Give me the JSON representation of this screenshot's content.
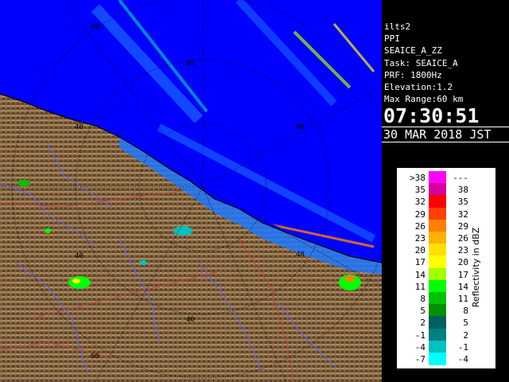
{
  "info": {
    "station": "ilts2",
    "mode": "PPI",
    "product": "SEAICE_A_ZZ",
    "task": "Task: SEAICE_A",
    "prf": "PRF: 1800Hz",
    "elevation": "Elevation:1.2",
    "max_range": "Max Range:60 km",
    "time": "07:30:51",
    "date": "30 MAR 2018 JST"
  },
  "range_labels": {
    "r40": "40",
    "r60": "60"
  },
  "legend": {
    "unit_label": "Reflectivity in dBZ",
    "rows": [
      {
        "lo": ">38",
        "hi": "---",
        "color": "#ff00ff"
      },
      {
        "lo": "35",
        "hi": "38",
        "color": "#d400a0"
      },
      {
        "lo": "32",
        "hi": "35",
        "color": "#ff0000"
      },
      {
        "lo": "29",
        "hi": "32",
        "color": "#ff4000"
      },
      {
        "lo": "26",
        "hi": "29",
        "color": "#ff8000"
      },
      {
        "lo": "23",
        "hi": "26",
        "color": "#ffb000"
      },
      {
        "lo": "20",
        "hi": "23",
        "color": "#ffe000"
      },
      {
        "lo": "17",
        "hi": "20",
        "color": "#ffff00"
      },
      {
        "lo": "14",
        "hi": "17",
        "color": "#a0ff00"
      },
      {
        "lo": "11",
        "hi": "14",
        "color": "#00ff00"
      },
      {
        "lo": "8",
        "hi": "11",
        "color": "#00c000"
      },
      {
        "lo": "5",
        "hi": "8",
        "color": "#009000"
      },
      {
        "lo": "2",
        "hi": "5",
        "color": "#006060"
      },
      {
        "lo": "-1",
        "hi": "2",
        "color": "#008080"
      },
      {
        "lo": "-4",
        "hi": "-1",
        "color": "#00c0c0"
      },
      {
        "lo": "-7",
        "hi": "-4",
        "color": "#00ffff"
      }
    ]
  },
  "colors": {
    "sea": "#0000ff",
    "land": "#8a6a44",
    "echo_blue": "#1e78ff",
    "ring": "#000000",
    "coast": "#000000",
    "river": "#6060ff",
    "road": "#c04040"
  }
}
